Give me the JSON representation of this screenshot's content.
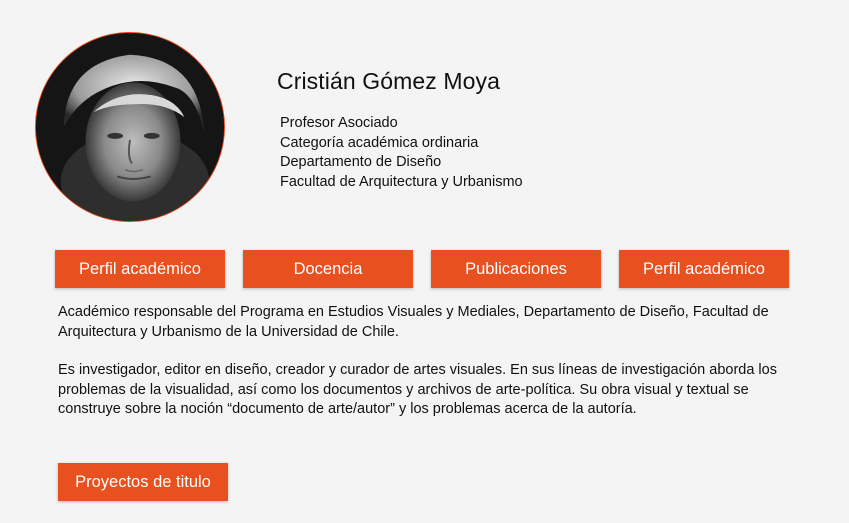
{
  "profile": {
    "name": "Cristián Gómez Moya",
    "details": [
      "Profesor Asociado",
      "Categoría académica ordinaria",
      "Departamento de Diseño",
      "Facultad de Arquitectura y Urbanismo"
    ]
  },
  "tabs": [
    {
      "label": "Perfil académico"
    },
    {
      "label": "Docencia"
    },
    {
      "label": "Publicaciones"
    },
    {
      "label": "Perfil académico"
    }
  ],
  "bio": {
    "paragraph1": "Académico responsable del Programa en Estudios Visuales y Mediales, Departamento de Diseño, Facultad de Arquitectura y Urbanismo de la Universidad de Chile.",
    "paragraph2": "Es investigador, editor en diseño, creador y curador de artes visuales. En sus líneas de investigación aborda los problemas de la visualidad, así como los documentos y archivos de arte-política. Su obra visual y textual se construye sobre la noción “documento de arte/autor” y los problemas acerca de la autoría."
  },
  "actions": {
    "projects_label": "Proyectos de titulo"
  },
  "colors": {
    "accent": "#e8501f",
    "background": "#f4f4f4",
    "text": "#111111"
  }
}
